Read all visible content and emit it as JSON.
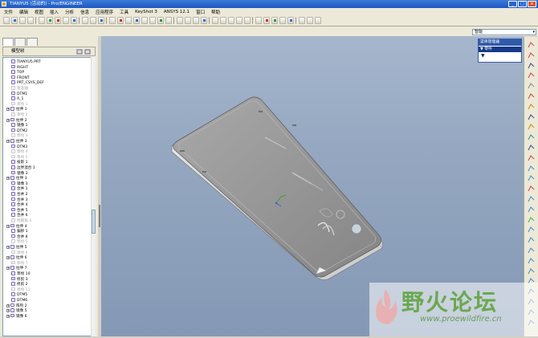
{
  "window": {
    "title": "TIANYU5 (活动的) - Pro/ENGINEER"
  },
  "menubar": [
    "文件",
    "编辑",
    "视图",
    "插入",
    "分析",
    "信息",
    "应用程序",
    "工具",
    "KeyShot 3",
    "ANSYS 12.1",
    "窗口",
    "帮助"
  ],
  "filter": {
    "value": "智能"
  },
  "model_tree": {
    "header": "模型树",
    "items": [
      {
        "label": "TIANYU5.PRT",
        "dim": false,
        "expander": false
      },
      {
        "label": "RIGHT",
        "dim": false,
        "expander": false
      },
      {
        "label": "TOP",
        "dim": false,
        "expander": false
      },
      {
        "label": "FRONT",
        "dim": false,
        "expander": false
      },
      {
        "label": "PRT_CSYS_DEF",
        "dim": false,
        "expander": false
      },
      {
        "label": "基准轴",
        "dim": true,
        "expander": false
      },
      {
        "label": "DTM1",
        "dim": false,
        "expander": false
      },
      {
        "label": "A_1",
        "dim": false,
        "expander": false
      },
      {
        "label": "草绘 1",
        "dim": true,
        "expander": false
      },
      {
        "label": "拉伸 1",
        "dim": false,
        "expander": true
      },
      {
        "label": "草绘 2",
        "dim": true,
        "expander": false
      },
      {
        "label": "拉伸 2",
        "dim": false,
        "expander": true
      },
      {
        "label": "镜像 1",
        "dim": false,
        "expander": false
      },
      {
        "label": "DTM2",
        "dim": false,
        "expander": false
      },
      {
        "label": "草绘 3",
        "dim": true,
        "expander": false
      },
      {
        "label": "拉伸 3",
        "dim": false,
        "expander": true
      },
      {
        "label": "DTM3",
        "dim": false,
        "expander": false
      },
      {
        "label": "草绘 4",
        "dim": true,
        "expander": false
      },
      {
        "label": "草绘 5",
        "dim": true,
        "expander": false
      },
      {
        "label": "投影 1",
        "dim": false,
        "expander": false
      },
      {
        "label": "边界混合 1",
        "dim": false,
        "expander": false
      },
      {
        "label": "镜像 3",
        "dim": false,
        "expander": false
      },
      {
        "label": "拉伸 3",
        "dim": false,
        "expander": true
      },
      {
        "label": "镜像 3",
        "dim": false,
        "expander": false
      },
      {
        "label": "合并 1",
        "dim": false,
        "expander": false
      },
      {
        "label": "合并 2",
        "dim": false,
        "expander": false
      },
      {
        "label": "合并 3",
        "dim": false,
        "expander": false
      },
      {
        "label": "合并 4",
        "dim": false,
        "expander": false
      },
      {
        "label": "合并 5",
        "dim": false,
        "expander": false
      },
      {
        "label": "合并 6",
        "dim": false,
        "expander": false
      },
      {
        "label": "倒圆角 4",
        "dim": true,
        "expander": false
      },
      {
        "label": "拉伸 4",
        "dim": false,
        "expander": true
      },
      {
        "label": "偏移 1",
        "dim": false,
        "expander": false
      },
      {
        "label": "合并 8",
        "dim": false,
        "expander": false
      },
      {
        "label": "草绘 5",
        "dim": true,
        "expander": false
      },
      {
        "label": "拉伸 5",
        "dim": false,
        "expander": true
      },
      {
        "label": "草绘 6",
        "dim": true,
        "expander": false
      },
      {
        "label": "拉伸 6",
        "dim": false,
        "expander": true
      },
      {
        "label": "草绘 7",
        "dim": true,
        "expander": false
      },
      {
        "label": "拉伸 7",
        "dim": false,
        "expander": true
      },
      {
        "label": "草绘 10",
        "dim": false,
        "expander": false
      },
      {
        "label": "修剪 3",
        "dim": false,
        "expander": false
      },
      {
        "label": "修剪 2",
        "dim": false,
        "expander": false
      },
      {
        "label": "草绘 11",
        "dim": true,
        "expander": false
      },
      {
        "label": "DTM5",
        "dim": false,
        "expander": false
      },
      {
        "label": "DTM6",
        "dim": false,
        "expander": false
      },
      {
        "label": "阵列 2",
        "dim": false,
        "expander": true
      },
      {
        "label": "镜像 5",
        "dim": false,
        "expander": true
      },
      {
        "label": "镜像 6",
        "dim": false,
        "expander": true
      }
    ]
  },
  "menu_manager": {
    "title": "菜单管理器",
    "item": "▼ 零件",
    "arrow": "▼"
  },
  "watermark": {
    "text": "野火论坛",
    "url": "www.proewildfire.cn"
  },
  "colors": {
    "viewport_top": "#a5b6cd",
    "viewport_bottom": "#8498b5",
    "part_body": "#8f8f8f",
    "title_blue": "#1d56c2"
  }
}
